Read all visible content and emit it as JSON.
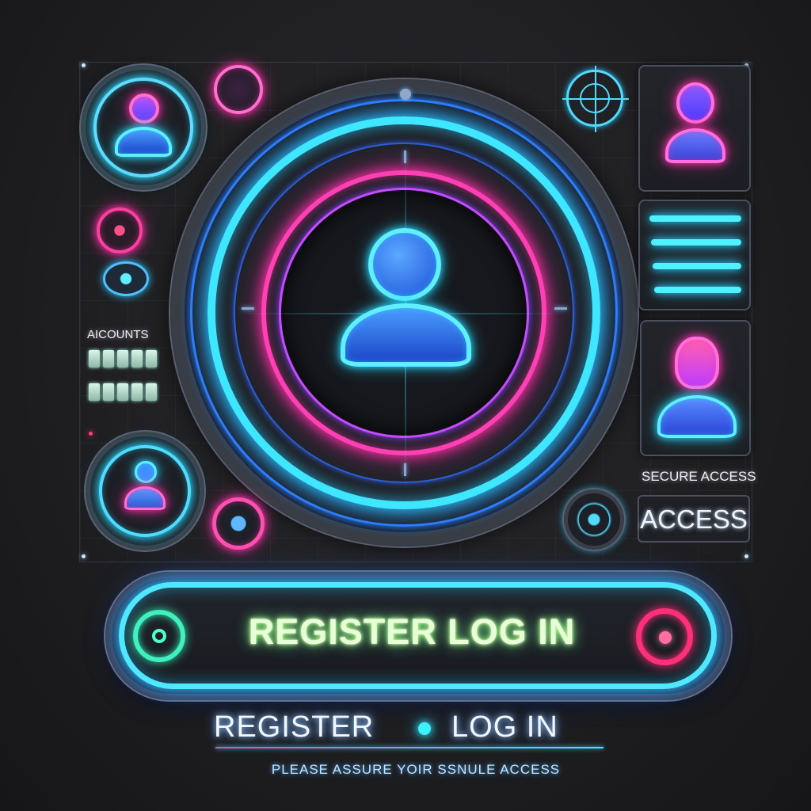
{
  "side_panel": {
    "title": "AICOUNTS",
    "status_label": "SECURE ACCESS",
    "access_button": "ACCESS"
  },
  "main_button": {
    "label": "REGISTER LOG IN"
  },
  "links": {
    "register": "REGISTER",
    "login": "LOG IN"
  },
  "footer_note": "PLEASE ASSURE YOIR SSNULE ACCESS",
  "colors": {
    "cyan": "#3fe6ff",
    "pink": "#ff3fb4",
    "green_text": "#e9ffd8",
    "background": "#1f1f22"
  },
  "icons": [
    "user-icon",
    "target-icon",
    "power-icon",
    "record-icon"
  ]
}
